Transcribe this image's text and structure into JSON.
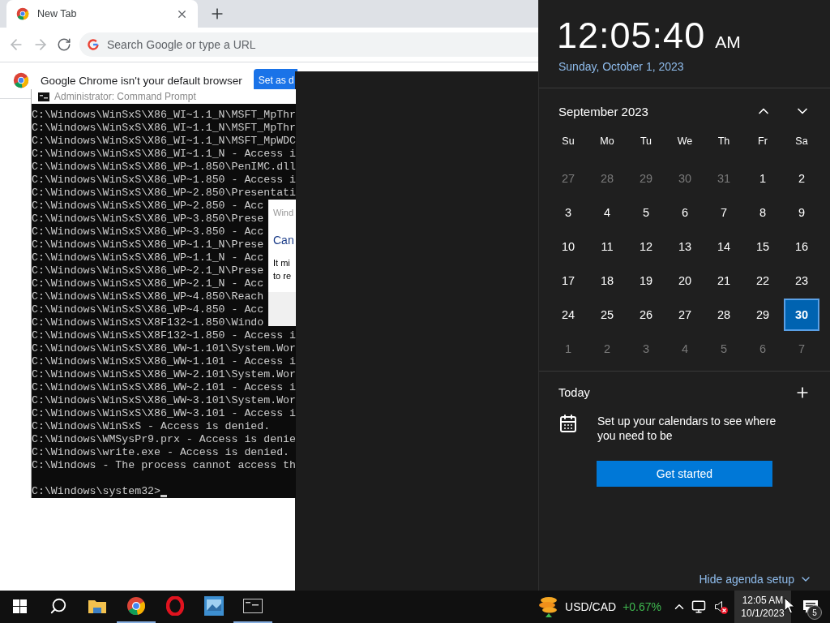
{
  "browser": {
    "tab": {
      "title": "New Tab",
      "selected": true
    },
    "omnibox": {
      "placeholder": "Search Google or type a URL"
    },
    "infobar": {
      "message": "Google Chrome isn't your default browser",
      "button": "Set as d"
    }
  },
  "cmd": {
    "title": "Administrator: Command Prompt",
    "lines": [
      "C:\\Windows\\WinSxS\\X86_WI~1.1_N\\MSFT_MpThr",
      "C:\\Windows\\WinSxS\\X86_WI~1.1_N\\MSFT_MpThr",
      "C:\\Windows\\WinSxS\\X86_WI~1.1_N\\MSFT_MpWDC",
      "C:\\Windows\\WinSxS\\X86_WI~1.1_N - Access i",
      "C:\\Windows\\WinSxS\\X86_WP~1.850\\PenIMC.dll",
      "C:\\Windows\\WinSxS\\X86_WP~1.850 - Access i",
      "C:\\Windows\\WinSxS\\X86_WP~2.850\\Presentati",
      "C:\\Windows\\WinSxS\\X86_WP~2.850 - Acc",
      "C:\\Windows\\WinSxS\\X86_WP~3.850\\Prese",
      "C:\\Windows\\WinSxS\\X86_WP~3.850 - Acc",
      "C:\\Windows\\WinSxS\\X86_WP~1.1_N\\Prese",
      "C:\\Windows\\WinSxS\\X86_WP~1.1_N - Acc",
      "C:\\Windows\\WinSxS\\X86_WP~2.1_N\\Prese",
      "C:\\Windows\\WinSxS\\X86_WP~2.1_N - Acc",
      "C:\\Windows\\WinSxS\\X86_WP~4.850\\Reach",
      "C:\\Windows\\WinSxS\\X86_WP~4.850 - Acc",
      "C:\\Windows\\WinSxS\\X8F132~1.850\\Windo",
      "C:\\Windows\\WinSxS\\X8F132~1.850 - Access i",
      "C:\\Windows\\WinSxS\\X86_WW~1.101\\System.Wor",
      "C:\\Windows\\WinSxS\\X86_WW~1.101 - Access i",
      "C:\\Windows\\WinSxS\\X86_WW~2.101\\System.Wor",
      "C:\\Windows\\WinSxS\\X86_WW~2.101 - Access i",
      "C:\\Windows\\WinSxS\\X86_WW~3.101\\System.Wor",
      "C:\\Windows\\WinSxS\\X86_WW~3.101 - Access i",
      "C:\\Windows\\WinSxS - Access is denied.",
      "C:\\Windows\\WMSysPr9.prx - Access is denie",
      "C:\\Windows\\write.exe - Access is denied.",
      "C:\\Windows - The process cannot access th"
    ],
    "prompt": "C:\\Windows\\system32>"
  },
  "dialog": {
    "title": "Wind",
    "heading": "Can",
    "body": [
      "It mi",
      "to re"
    ]
  },
  "clock_flyout": {
    "time": "12:05:40",
    "meridiem": "AM",
    "date": "Sunday, October 1, 2023",
    "month": "September 2023",
    "weekdays": [
      "Su",
      "Mo",
      "Tu",
      "We",
      "Th",
      "Fr",
      "Sa"
    ],
    "weeks": [
      [
        {
          "day": "27",
          "in_month": false,
          "selected": false
        },
        {
          "day": "28",
          "in_month": false,
          "selected": false
        },
        {
          "day": "29",
          "in_month": false,
          "selected": false
        },
        {
          "day": "30",
          "in_month": false,
          "selected": false
        },
        {
          "day": "31",
          "in_month": false,
          "selected": false
        },
        {
          "day": "1",
          "in_month": true,
          "selected": false
        },
        {
          "day": "2",
          "in_month": true,
          "selected": false
        }
      ],
      [
        {
          "day": "3",
          "in_month": true,
          "selected": false
        },
        {
          "day": "4",
          "in_month": true,
          "selected": false
        },
        {
          "day": "5",
          "in_month": true,
          "selected": false
        },
        {
          "day": "6",
          "in_month": true,
          "selected": false
        },
        {
          "day": "7",
          "in_month": true,
          "selected": false
        },
        {
          "day": "8",
          "in_month": true,
          "selected": false
        },
        {
          "day": "9",
          "in_month": true,
          "selected": false
        }
      ],
      [
        {
          "day": "10",
          "in_month": true,
          "selected": false
        },
        {
          "day": "11",
          "in_month": true,
          "selected": false
        },
        {
          "day": "12",
          "in_month": true,
          "selected": false
        },
        {
          "day": "13",
          "in_month": true,
          "selected": false
        },
        {
          "day": "14",
          "in_month": true,
          "selected": false
        },
        {
          "day": "15",
          "in_month": true,
          "selected": false
        },
        {
          "day": "16",
          "in_month": true,
          "selected": false
        }
      ],
      [
        {
          "day": "17",
          "in_month": true,
          "selected": false
        },
        {
          "day": "18",
          "in_month": true,
          "selected": false
        },
        {
          "day": "19",
          "in_month": true,
          "selected": false
        },
        {
          "day": "20",
          "in_month": true,
          "selected": false
        },
        {
          "day": "21",
          "in_month": true,
          "selected": false
        },
        {
          "day": "22",
          "in_month": true,
          "selected": false
        },
        {
          "day": "23",
          "in_month": true,
          "selected": false
        }
      ],
      [
        {
          "day": "24",
          "in_month": true,
          "selected": false
        },
        {
          "day": "25",
          "in_month": true,
          "selected": false
        },
        {
          "day": "26",
          "in_month": true,
          "selected": false
        },
        {
          "day": "27",
          "in_month": true,
          "selected": false
        },
        {
          "day": "28",
          "in_month": true,
          "selected": false
        },
        {
          "day": "29",
          "in_month": true,
          "selected": false
        },
        {
          "day": "30",
          "in_month": true,
          "selected": true
        }
      ],
      [
        {
          "day": "1",
          "in_month": false,
          "selected": false
        },
        {
          "day": "2",
          "in_month": false,
          "selected": false
        },
        {
          "day": "3",
          "in_month": false,
          "selected": false
        },
        {
          "day": "4",
          "in_month": false,
          "selected": false
        },
        {
          "day": "5",
          "in_month": false,
          "selected": false
        },
        {
          "day": "6",
          "in_month": false,
          "selected": false
        },
        {
          "day": "7",
          "in_month": false,
          "selected": false
        }
      ]
    ],
    "agenda": {
      "title": "Today",
      "message": "Set up your calendars to see where you need to be",
      "button": "Get started",
      "hide_link": "Hide agenda setup"
    }
  },
  "taskbar": {
    "apps": [
      {
        "kind": "start",
        "running": false
      },
      {
        "kind": "search",
        "running": false
      },
      {
        "kind": "explorer",
        "running": false
      },
      {
        "kind": "chrome",
        "running": true
      },
      {
        "kind": "opera",
        "running": false
      },
      {
        "kind": "photos",
        "running": false
      },
      {
        "kind": "terminal",
        "running": true
      }
    ],
    "ticker": {
      "symbol": "USD/CAD",
      "change": "+0.67%"
    },
    "speaker": {
      "muted": true
    },
    "clock": {
      "time": "12:05 AM",
      "date": "10/1/2023"
    },
    "notifications": {
      "count": "5"
    }
  }
}
